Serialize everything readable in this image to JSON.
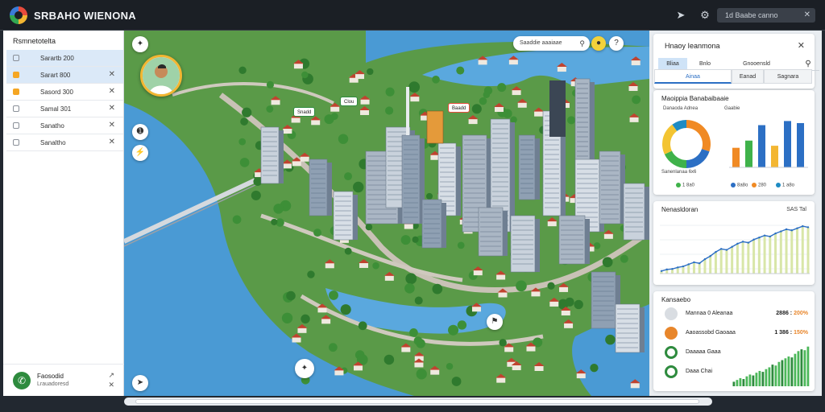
{
  "app": {
    "title": "SRBAHO WIENONA",
    "search_text": "1d Baabe canno",
    "accent": "#2c6fc4"
  },
  "toolbar": {
    "share_icon": "share-icon",
    "settings_icon": "settings-icon",
    "minimize": "—",
    "maximize": "☐",
    "close": "✕"
  },
  "left_panel": {
    "title": "Rsmnetotelta",
    "items": [
      {
        "label": "Sarartb 200",
        "active": true,
        "filled": false
      },
      {
        "label": "Sarart 800",
        "active": true,
        "filled": true
      },
      {
        "label": "Sasord 300",
        "active": false,
        "filled": true
      },
      {
        "label": "Samal 301",
        "active": false,
        "filled": false
      },
      {
        "label": "Sanatho",
        "active": false,
        "filled": false
      },
      {
        "label": "Sanaltho",
        "active": false,
        "filled": false
      }
    ],
    "footer": {
      "title": "Faosodid",
      "subtitle": "Lrauadoresd"
    }
  },
  "map": {
    "search_placeholder": "Saaddie aaaiaae",
    "tags": [
      "Snadd",
      "Clou",
      "Baadd"
    ]
  },
  "right_panel": {
    "title": "Hnaoy Ieanmona",
    "tabs": [
      "Bliaa",
      "Bnlo",
      "Gnooensld"
    ],
    "subtabs": [
      "Ainaa",
      "Eanad",
      "Sagnara"
    ],
    "donut_card": {
      "title": "Maoippia Banabaibaaie",
      "donut_label": "Danaoda Adnea",
      "bar_label": "Gaabie",
      "footer_label": "Sanenlanaa 6x6",
      "legend": [
        "1 8a0",
        "8a8o",
        "280",
        "1 a8o"
      ]
    },
    "line_card": {
      "title": "Nenasldoran",
      "value": "SAS Tal"
    },
    "stats_card": {
      "title": "Kansaebo",
      "rows": [
        {
          "label": "Mannaa 0 Aleanaa",
          "value": "2886",
          "pct": "200%",
          "icon": "circle-icon",
          "color": "#d9dde2"
        },
        {
          "label": "Aaoassobd Gaoaaa",
          "value": "1 386",
          "pct": "150%",
          "icon": "orange-circle-icon",
          "color": "#e8862b"
        },
        {
          "label": "Daaaaa Gaaa",
          "value": "",
          "pct": "",
          "icon": "green-ring-icon",
          "color": "#2e8b3e"
        },
        {
          "label": "Daaa Chai",
          "value": "",
          "pct": "",
          "icon": "green-ring-icon",
          "color": "#2e8b3e"
        }
      ]
    }
  },
  "chart_data": [
    {
      "type": "pie",
      "values": [
        30,
        20,
        18,
        22,
        10
      ],
      "colors": [
        "#f08a24",
        "#2c6fc4",
        "#3fb24a",
        "#f3c432",
        "#1e8bc3"
      ]
    },
    {
      "type": "bar",
      "categories": [
        "1",
        "2",
        "3",
        "4",
        "5",
        "6"
      ],
      "values": [
        38,
        52,
        82,
        42,
        90,
        86
      ],
      "colors": [
        "#f08a24",
        "#3fb24a",
        "#2c6fc4",
        "#f3b632",
        "#2c6fc4",
        "#2c6fc4"
      ],
      "ylim": [
        0,
        100
      ]
    },
    {
      "type": "line",
      "values": [
        5,
        8,
        9,
        12,
        14,
        18,
        22,
        20,
        28,
        34,
        42,
        48,
        46,
        52,
        58,
        62,
        60,
        66,
        70,
        74,
        72,
        78,
        82,
        86,
        84,
        88,
        92,
        90
      ],
      "ylim": [
        0,
        100
      ]
    },
    {
      "type": "bar",
      "values": [
        10,
        14,
        18,
        16,
        22,
        26,
        24,
        30,
        34,
        32,
        38,
        42,
        48,
        46,
        54,
        58,
        62,
        66,
        64,
        72,
        78,
        82,
        80,
        88
      ],
      "ylim": [
        0,
        100
      ]
    }
  ]
}
